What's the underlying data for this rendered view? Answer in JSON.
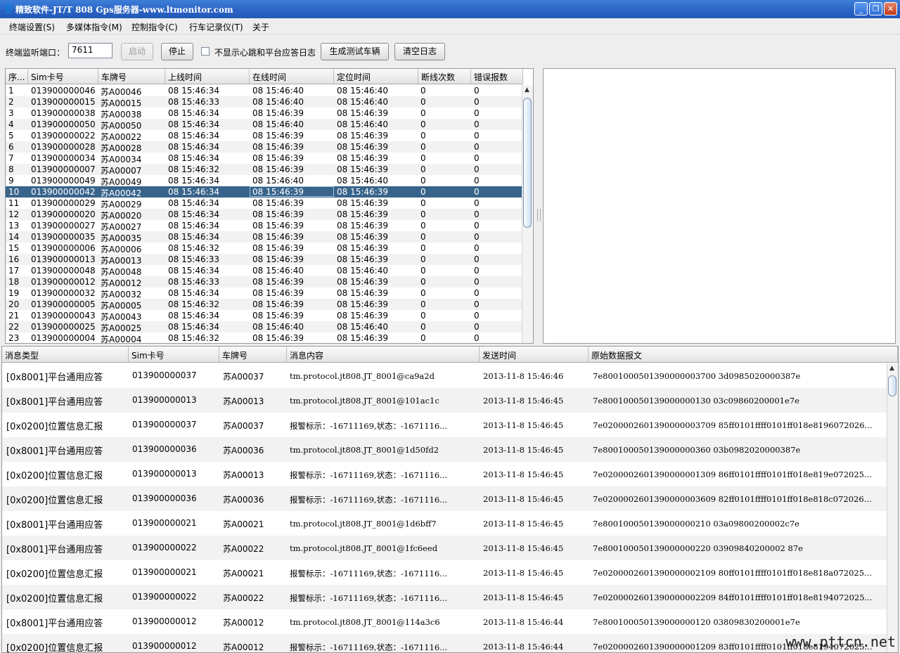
{
  "window": {
    "title": "精致软件-JT/T 808 Gps服务器-www.ltmonitor.com",
    "app_icon": "person-icon",
    "minimize": "_",
    "restore": "❐",
    "close": "✕"
  },
  "menu": [
    "终端设置(S)",
    "多媒体指令(M)",
    "控制指令(C)",
    "行车记录仪(T)",
    "关于"
  ],
  "toolbar": {
    "port_label": "终端监听端口：",
    "port_value": "7611",
    "start_label": "启动",
    "stop_label": "停止",
    "hide_heartbeat_label": "不显示心跳和平台应答日志",
    "generate_label": "生成测试车辆",
    "clear_label": "清空日志"
  },
  "terminal_table": {
    "columns": [
      "序...",
      "Sim卡号",
      "车牌号",
      "上线时间",
      "在线时间",
      "定位时间",
      "断线次数",
      "错误报数"
    ],
    "selected_row": 10,
    "rows": [
      [
        "1",
        "013900000046",
        "苏A00046",
        "08 15:46:34",
        "08 15:46:40",
        "08 15:46:40",
        "0",
        "0"
      ],
      [
        "2",
        "013900000015",
        "苏A00015",
        "08 15:46:33",
        "08 15:46:40",
        "08 15:46:40",
        "0",
        "0"
      ],
      [
        "3",
        "013900000038",
        "苏A00038",
        "08 15:46:34",
        "08 15:46:39",
        "08 15:46:39",
        "0",
        "0"
      ],
      [
        "4",
        "013900000050",
        "苏A00050",
        "08 15:46:34",
        "08 15:46:40",
        "08 15:46:40",
        "0",
        "0"
      ],
      [
        "5",
        "013900000022",
        "苏A00022",
        "08 15:46:34",
        "08 15:46:39",
        "08 15:46:39",
        "0",
        "0"
      ],
      [
        "6",
        "013900000028",
        "苏A00028",
        "08 15:46:34",
        "08 15:46:39",
        "08 15:46:39",
        "0",
        "0"
      ],
      [
        "7",
        "013900000034",
        "苏A00034",
        "08 15:46:34",
        "08 15:46:39",
        "08 15:46:39",
        "0",
        "0"
      ],
      [
        "8",
        "013900000007",
        "苏A00007",
        "08 15:46:32",
        "08 15:46:39",
        "08 15:46:39",
        "0",
        "0"
      ],
      [
        "9",
        "013900000049",
        "苏A00049",
        "08 15:46:34",
        "08 15:46:40",
        "08 15:46:40",
        "0",
        "0"
      ],
      [
        "10",
        "013900000042",
        "苏A00042",
        "08 15:46:34",
        "08 15:46:39",
        "08 15:46:39",
        "0",
        "0"
      ],
      [
        "11",
        "013900000029",
        "苏A00029",
        "08 15:46:34",
        "08 15:46:39",
        "08 15:46:39",
        "0",
        "0"
      ],
      [
        "12",
        "013900000020",
        "苏A00020",
        "08 15:46:34",
        "08 15:46:39",
        "08 15:46:39",
        "0",
        "0"
      ],
      [
        "13",
        "013900000027",
        "苏A00027",
        "08 15:46:34",
        "08 15:46:39",
        "08 15:46:39",
        "0",
        "0"
      ],
      [
        "14",
        "013900000035",
        "苏A00035",
        "08 15:46:34",
        "08 15:46:39",
        "08 15:46:39",
        "0",
        "0"
      ],
      [
        "15",
        "013900000006",
        "苏A00006",
        "08 15:46:32",
        "08 15:46:39",
        "08 15:46:39",
        "0",
        "0"
      ],
      [
        "16",
        "013900000013",
        "苏A00013",
        "08 15:46:33",
        "08 15:46:39",
        "08 15:46:39",
        "0",
        "0"
      ],
      [
        "17",
        "013900000048",
        "苏A00048",
        "08 15:46:34",
        "08 15:46:40",
        "08 15:46:40",
        "0",
        "0"
      ],
      [
        "18",
        "013900000012",
        "苏A00012",
        "08 15:46:33",
        "08 15:46:39",
        "08 15:46:39",
        "0",
        "0"
      ],
      [
        "19",
        "013900000032",
        "苏A00032",
        "08 15:46:34",
        "08 15:46:39",
        "08 15:46:39",
        "0",
        "0"
      ],
      [
        "20",
        "013900000005",
        "苏A00005",
        "08 15:46:32",
        "08 15:46:39",
        "08 15:46:39",
        "0",
        "0"
      ],
      [
        "21",
        "013900000043",
        "苏A00043",
        "08 15:46:34",
        "08 15:46:39",
        "08 15:46:39",
        "0",
        "0"
      ],
      [
        "22",
        "013900000025",
        "苏A00025",
        "08 15:46:34",
        "08 15:46:40",
        "08 15:46:40",
        "0",
        "0"
      ],
      [
        "23",
        "013900000004",
        "苏A00004",
        "08 15:46:32",
        "08 15:46:39",
        "08 15:46:39",
        "0",
        "0"
      ]
    ]
  },
  "log_table": {
    "columns": [
      "消息类型",
      "Sim卡号",
      "车牌号",
      "消息内容",
      "发送时间",
      "原始数据报文"
    ],
    "rows": [
      [
        "[0x8001]平台通用应答",
        "013900000037",
        "苏A00037",
        "tm.protocol.jt808.JT_8001@ca9a2d",
        "2013-11-8 15:46:46",
        "7e8001000501390000003700 3d0985020000387e"
      ],
      [
        "[0x8001]平台通用应答",
        "013900000013",
        "苏A00013",
        "tm.protocol.jt808.JT_8001@101ac1c",
        "2013-11-8 15:46:45",
        "7e800100050139000000130 03c09860200001e7e"
      ],
      [
        "[0x0200]位置信息汇报",
        "013900000037",
        "苏A00037",
        "报警标示：-16711169,状态：-1671116...",
        "2013-11-8 15:46:45",
        "7e0200002601390000003709 85ff0101ffff0101ff018e8196072026..."
      ],
      [
        "[0x8001]平台通用应答",
        "013900000036",
        "苏A00036",
        "tm.protocol.jt808.JT_8001@1d50fd2",
        "2013-11-8 15:46:45",
        "7e800100050139000000360 03b0982020000387e"
      ],
      [
        "[0x0200]位置信息汇报",
        "013900000013",
        "苏A00013",
        "报警标示：-16711169,状态：-1671116...",
        "2013-11-8 15:46:45",
        "7e0200002601390000001309 86ff0101ffff0101ff018e819e072025..."
      ],
      [
        "[0x0200]位置信息汇报",
        "013900000036",
        "苏A00036",
        "报警标示：-16711169,状态：-1671116...",
        "2013-11-8 15:46:45",
        "7e0200002601390000003609 82ff0101ffff0101ff018e818c072026..."
      ],
      [
        "[0x8001]平台通用应答",
        "013900000021",
        "苏A00021",
        "tm.protocol.jt808.JT_8001@1d6bff7",
        "2013-11-8 15:46:45",
        "7e800100050139000000210 03a09800200002c7e"
      ],
      [
        "[0x8001]平台通用应答",
        "013900000022",
        "苏A00022",
        "tm.protocol.jt808.JT_8001@1fc6eed",
        "2013-11-8 15:46:45",
        "7e800100050139000000220 03909840200002 87e"
      ],
      [
        "[0x0200]位置信息汇报",
        "013900000021",
        "苏A00021",
        "报警标示：-16711169,状态：-1671116...",
        "2013-11-8 15:46:45",
        "7e0200002601390000002109 80ff0101ffff0101ff018e818a072025..."
      ],
      [
        "[0x0200]位置信息汇报",
        "013900000022",
        "苏A00022",
        "报警标示：-16711169,状态：-1671116...",
        "2013-11-8 15:46:45",
        "7e0200002601390000002209 84ff0101ffff0101ff018e8194072025..."
      ],
      [
        "[0x8001]平台通用应答",
        "013900000012",
        "苏A00012",
        "tm.protocol.jt808.JT_8001@114a3c6",
        "2013-11-8 15:46:44",
        "7e800100050139000000120 03809830200001e7e"
      ],
      [
        "[0x0200]位置信息汇报",
        "013900000012",
        "苏A00012",
        "报警标示：-16711169,状态：-1671116...",
        "2013-11-8 15:46:44",
        "7e0200002601390000001209 83ff0101ffff0101ff018e8194072025..."
      ]
    ]
  },
  "watermark": "www.pttcn.net",
  "colors": {
    "title_bar": "#2a62c4",
    "selected_row": "#38648b"
  }
}
